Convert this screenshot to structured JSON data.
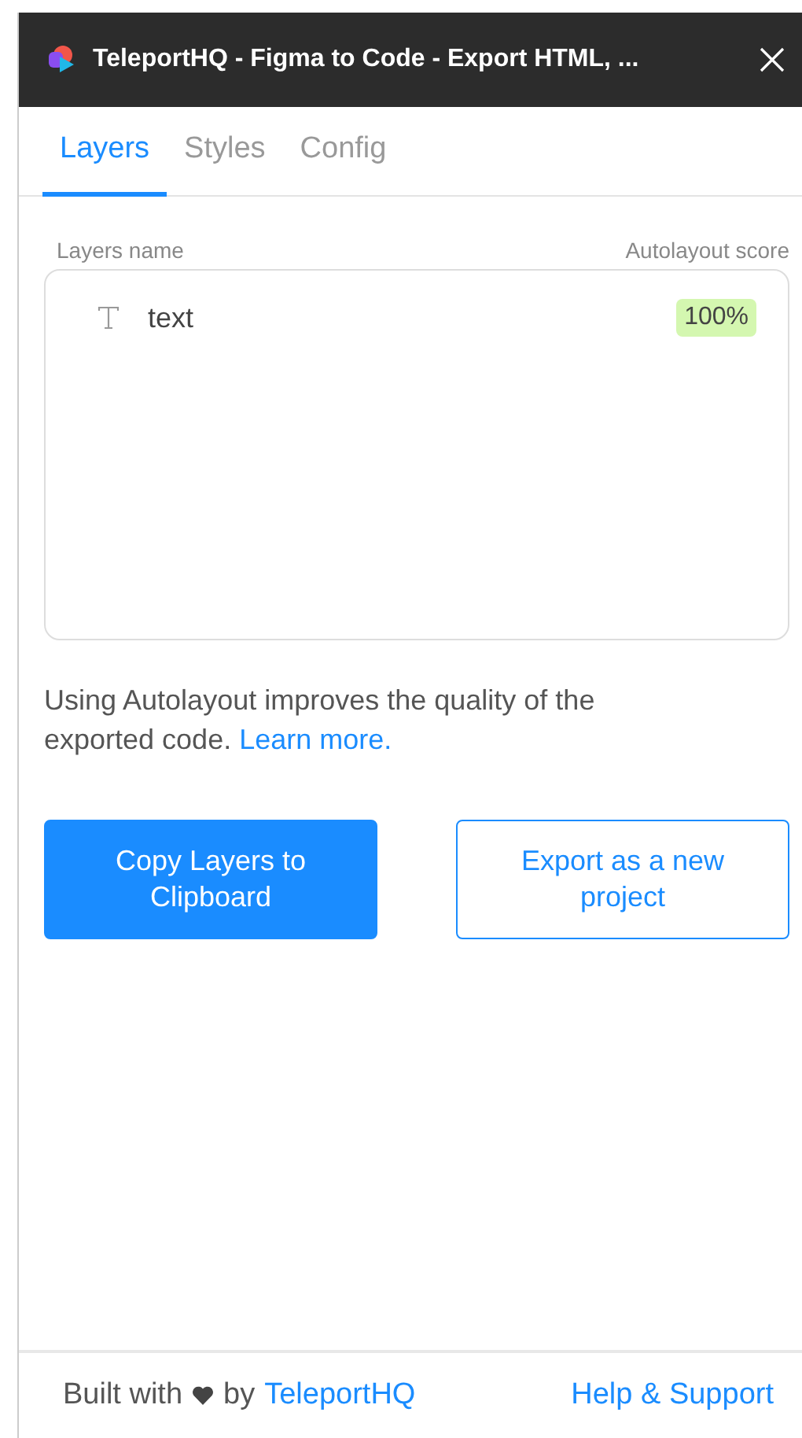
{
  "window": {
    "title": "TeleportHQ - Figma to Code - Export HTML, ..."
  },
  "tabs": [
    {
      "label": "Layers",
      "selected": true
    },
    {
      "label": "Styles",
      "selected": false
    },
    {
      "label": "Config",
      "selected": false
    }
  ],
  "layers": {
    "name_header": "Layers name",
    "score_header": "Autolayout score",
    "rows": [
      {
        "name": "text",
        "score": "100%"
      }
    ]
  },
  "hint": {
    "text": "Using Autolayout improves the quality of the exported code. ",
    "link": "Learn more."
  },
  "buttons": [
    {
      "label": "Copy Layers to Clipboard",
      "kind": "primary"
    },
    {
      "label": "Export as a new project",
      "kind": "outline"
    }
  ],
  "footer": {
    "built_with": "Built with",
    "by": "by",
    "brand_link": "TeleportHQ",
    "help_link": "Help & Support"
  }
}
